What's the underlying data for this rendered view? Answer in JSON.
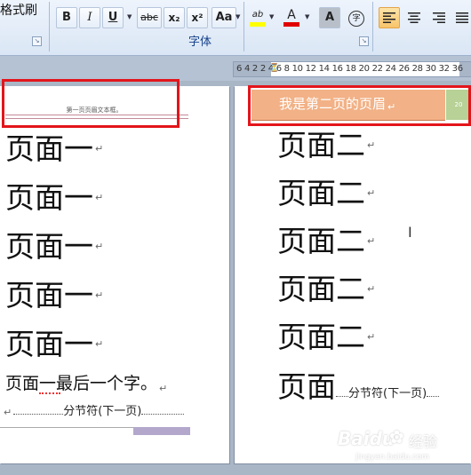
{
  "ribbon": {
    "format_painter_label": "格式刷",
    "font_group_label": "字体",
    "buttons": {
      "bold": "B",
      "italic": "I",
      "underline": "U",
      "strikethrough": "abc",
      "subscript": "x₂",
      "superscript": "x²",
      "change_case": "Aa",
      "highlight": "ab",
      "font_color": "A",
      "char_shading": "A",
      "enclose": "字"
    }
  },
  "ruler": {
    "text": "6 4 2  2 4 6 8 10 12 14 16 18 20 22 24 26 28 30 32  36"
  },
  "page1": {
    "header_text": "第一页页眉文本框。",
    "lines": [
      "页面一",
      "页面一",
      "页面一",
      "页面一",
      "页面一"
    ],
    "last_line": "页面一最后一个字。",
    "section_break": "分节符(下一页)"
  },
  "page2": {
    "header_text": "我是第二页的页眉",
    "header_side": "20",
    "lines": [
      "页面二",
      "页面二",
      "页面二",
      "页面二",
      "页面二"
    ],
    "last_line": "页面",
    "section_break": "分节符(下一页)"
  },
  "watermark": {
    "brand": "Baidu",
    "suffix": "经验",
    "url": "jingyan.baidu.com"
  },
  "colors": {
    "highlight_yellow": "#ffff00",
    "font_red": "#e00000",
    "header_orange": "#f2b186",
    "annotation_red": "#e3151b"
  }
}
